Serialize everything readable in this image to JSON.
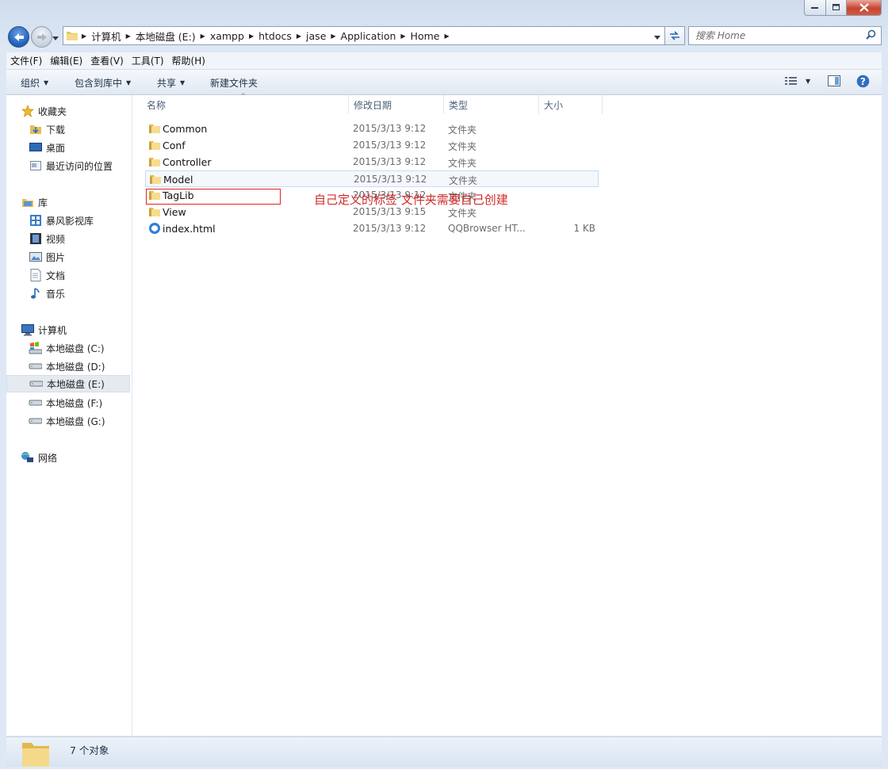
{
  "window": {
    "caption_buttons": {
      "minimize": "minimize",
      "maximize": "maximize",
      "close": "close"
    }
  },
  "address": {
    "crumbs": [
      "计算机",
      "本地磁盘 (E:)",
      "xampp",
      "htdocs",
      "jase",
      "Application",
      "Home"
    ]
  },
  "search": {
    "placeholder": "搜索 Home"
  },
  "menubar": [
    "文件(F)",
    "编辑(E)",
    "查看(V)",
    "工具(T)",
    "帮助(H)"
  ],
  "toolbar": {
    "organize": "组织",
    "include_library": "包含到库中",
    "share": "共享",
    "new_folder": "新建文件夹"
  },
  "sidebar": {
    "favorites": {
      "label": "收藏夹",
      "items": [
        "下载",
        "桌面",
        "最近访问的位置"
      ]
    },
    "libraries": {
      "label": "库",
      "items": [
        "暴风影视库",
        "视频",
        "图片",
        "文档",
        "音乐"
      ]
    },
    "computer": {
      "label": "计算机",
      "items": [
        "本地磁盘 (C:)",
        "本地磁盘 (D:)",
        "本地磁盘 (E:)",
        "本地磁盘 (F:)",
        "本地磁盘 (G:)"
      ]
    },
    "network": {
      "label": "网络"
    }
  },
  "columns": {
    "name": "名称",
    "modified": "修改日期",
    "type": "类型",
    "size": "大小"
  },
  "files": [
    {
      "name": "Common",
      "modified": "2015/3/13 9:12",
      "type": "文件夹",
      "size": "",
      "icon": "folder-icon"
    },
    {
      "name": "Conf",
      "modified": "2015/3/13 9:12",
      "type": "文件夹",
      "size": "",
      "icon": "folder-icon"
    },
    {
      "name": "Controller",
      "modified": "2015/3/13 9:12",
      "type": "文件夹",
      "size": "",
      "icon": "folder-icon"
    },
    {
      "name": "Model",
      "modified": "2015/3/13 9:12",
      "type": "文件夹",
      "size": "",
      "icon": "folder-icon"
    },
    {
      "name": "TagLib",
      "modified": "2015/3/13 9:12",
      "type": "文件夹",
      "size": "",
      "icon": "folder-icon"
    },
    {
      "name": "View",
      "modified": "2015/3/13 9:15",
      "type": "文件夹",
      "size": "",
      "icon": "folder-icon"
    },
    {
      "name": "index.html",
      "modified": "2015/3/13 9:12",
      "type": "QQBrowser HT...",
      "size": "1 KB",
      "icon": "html-file-icon"
    }
  ],
  "annotation": "自己定义的标签 文件夹需要自己创建",
  "annotation_color": "#d12b2b",
  "status": "7 个对象"
}
